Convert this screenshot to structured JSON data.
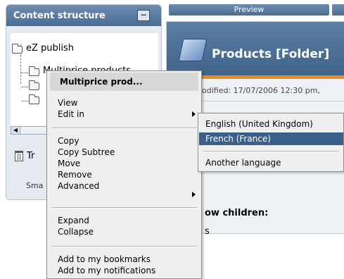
{
  "sidebar": {
    "header_title": "Content structure",
    "collapse_symbol": "−",
    "tree": {
      "root": "eZ publish",
      "children": [
        "Multiprice products",
        "",
        ""
      ]
    },
    "trash_label": "Tr",
    "small_label": "Sma",
    "scroll_left_symbol": "◀"
  },
  "main": {
    "preview_tab_label": "Preview",
    "page_title": "Products [Folder]",
    "modified_text": "odified: 17/07/2006 12:30 pm,",
    "children_heading": "ow children:",
    "children_text": "s"
  },
  "context_menu": {
    "header": "Multiprice prod...",
    "groups": [
      [
        "View",
        "Edit in"
      ],
      [
        "Copy",
        "Copy Subtree",
        "Move",
        "Remove",
        "Advanced"
      ],
      [
        "Expand",
        "Collapse"
      ],
      [
        "Add to my bookmarks",
        "Add to my notifications"
      ]
    ]
  },
  "submenu": {
    "items": [
      "English (United Kingdom)",
      "French (France)",
      "Another language"
    ],
    "selected": "French (France)"
  },
  "colors": {
    "header_blue": "#4c6d93",
    "accent_orange": "#f08a1c",
    "selection_blue": "#3a5f8a",
    "menu_bg": "#efefef"
  },
  "icons": [
    "folder-icon",
    "trash-icon",
    "submenu-arrow-icon"
  ]
}
